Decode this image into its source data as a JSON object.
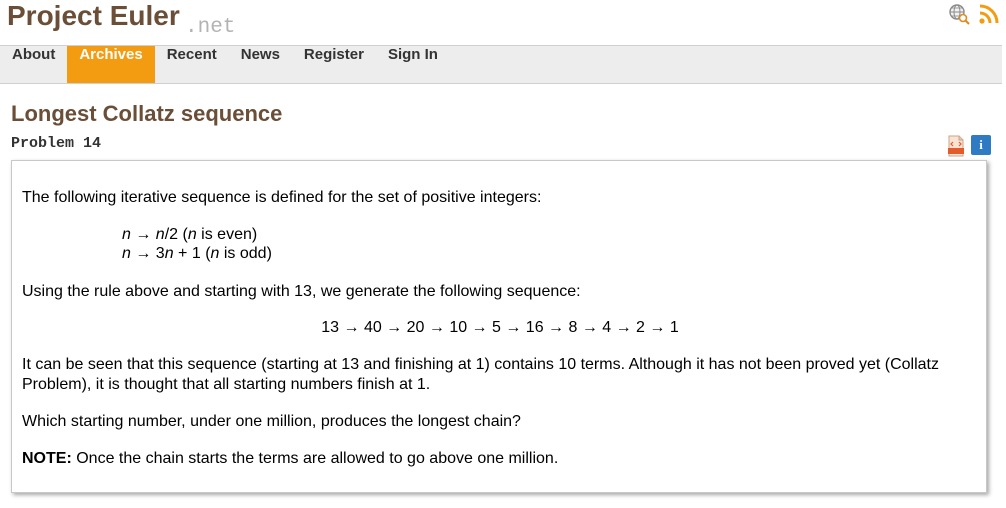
{
  "header": {
    "logo_main": "Project Euler",
    "logo_net": ".net",
    "icons": [
      "globe-search-icon",
      "rss-icon"
    ]
  },
  "nav": {
    "items": [
      "About",
      "Archives",
      "Recent",
      "News",
      "Register",
      "Sign In"
    ],
    "active": "Archives"
  },
  "problem": {
    "title": "Longest Collatz sequence",
    "number": "Problem 14",
    "icons": [
      "html-file-icon",
      "info-icon"
    ],
    "info_glyph": "i",
    "intro": "The following iterative sequence is defined for the set of positive integers:",
    "rule_even": {
      "a": "n",
      "b": " → ",
      "c": "n",
      "d": "/2 (",
      "e": "n",
      "f": " is even)"
    },
    "rule_odd": {
      "a": "n",
      "b": " → 3",
      "c": "n",
      "d": " + 1 (",
      "e": "n",
      "f": " is odd)"
    },
    "using": "Using the rule above and starting with 13, we generate the following sequence:",
    "sequence": "13 → 40 → 20 → 10 → 5 → 16 → 8 → 4 → 2 → 1",
    "seen_line1": "It can be seen that this sequence (starting at 13 and finishing at 1) contains 10 terms. Although it has not been proved yet (Collatz",
    "seen_line2": "Problem), it is thought that all starting numbers finish at 1.",
    "question": "Which starting number, under one million, produces the longest chain?",
    "note_label": "NOTE:",
    "note_text": " Once the chain starts the terms are allowed to go above one million."
  }
}
